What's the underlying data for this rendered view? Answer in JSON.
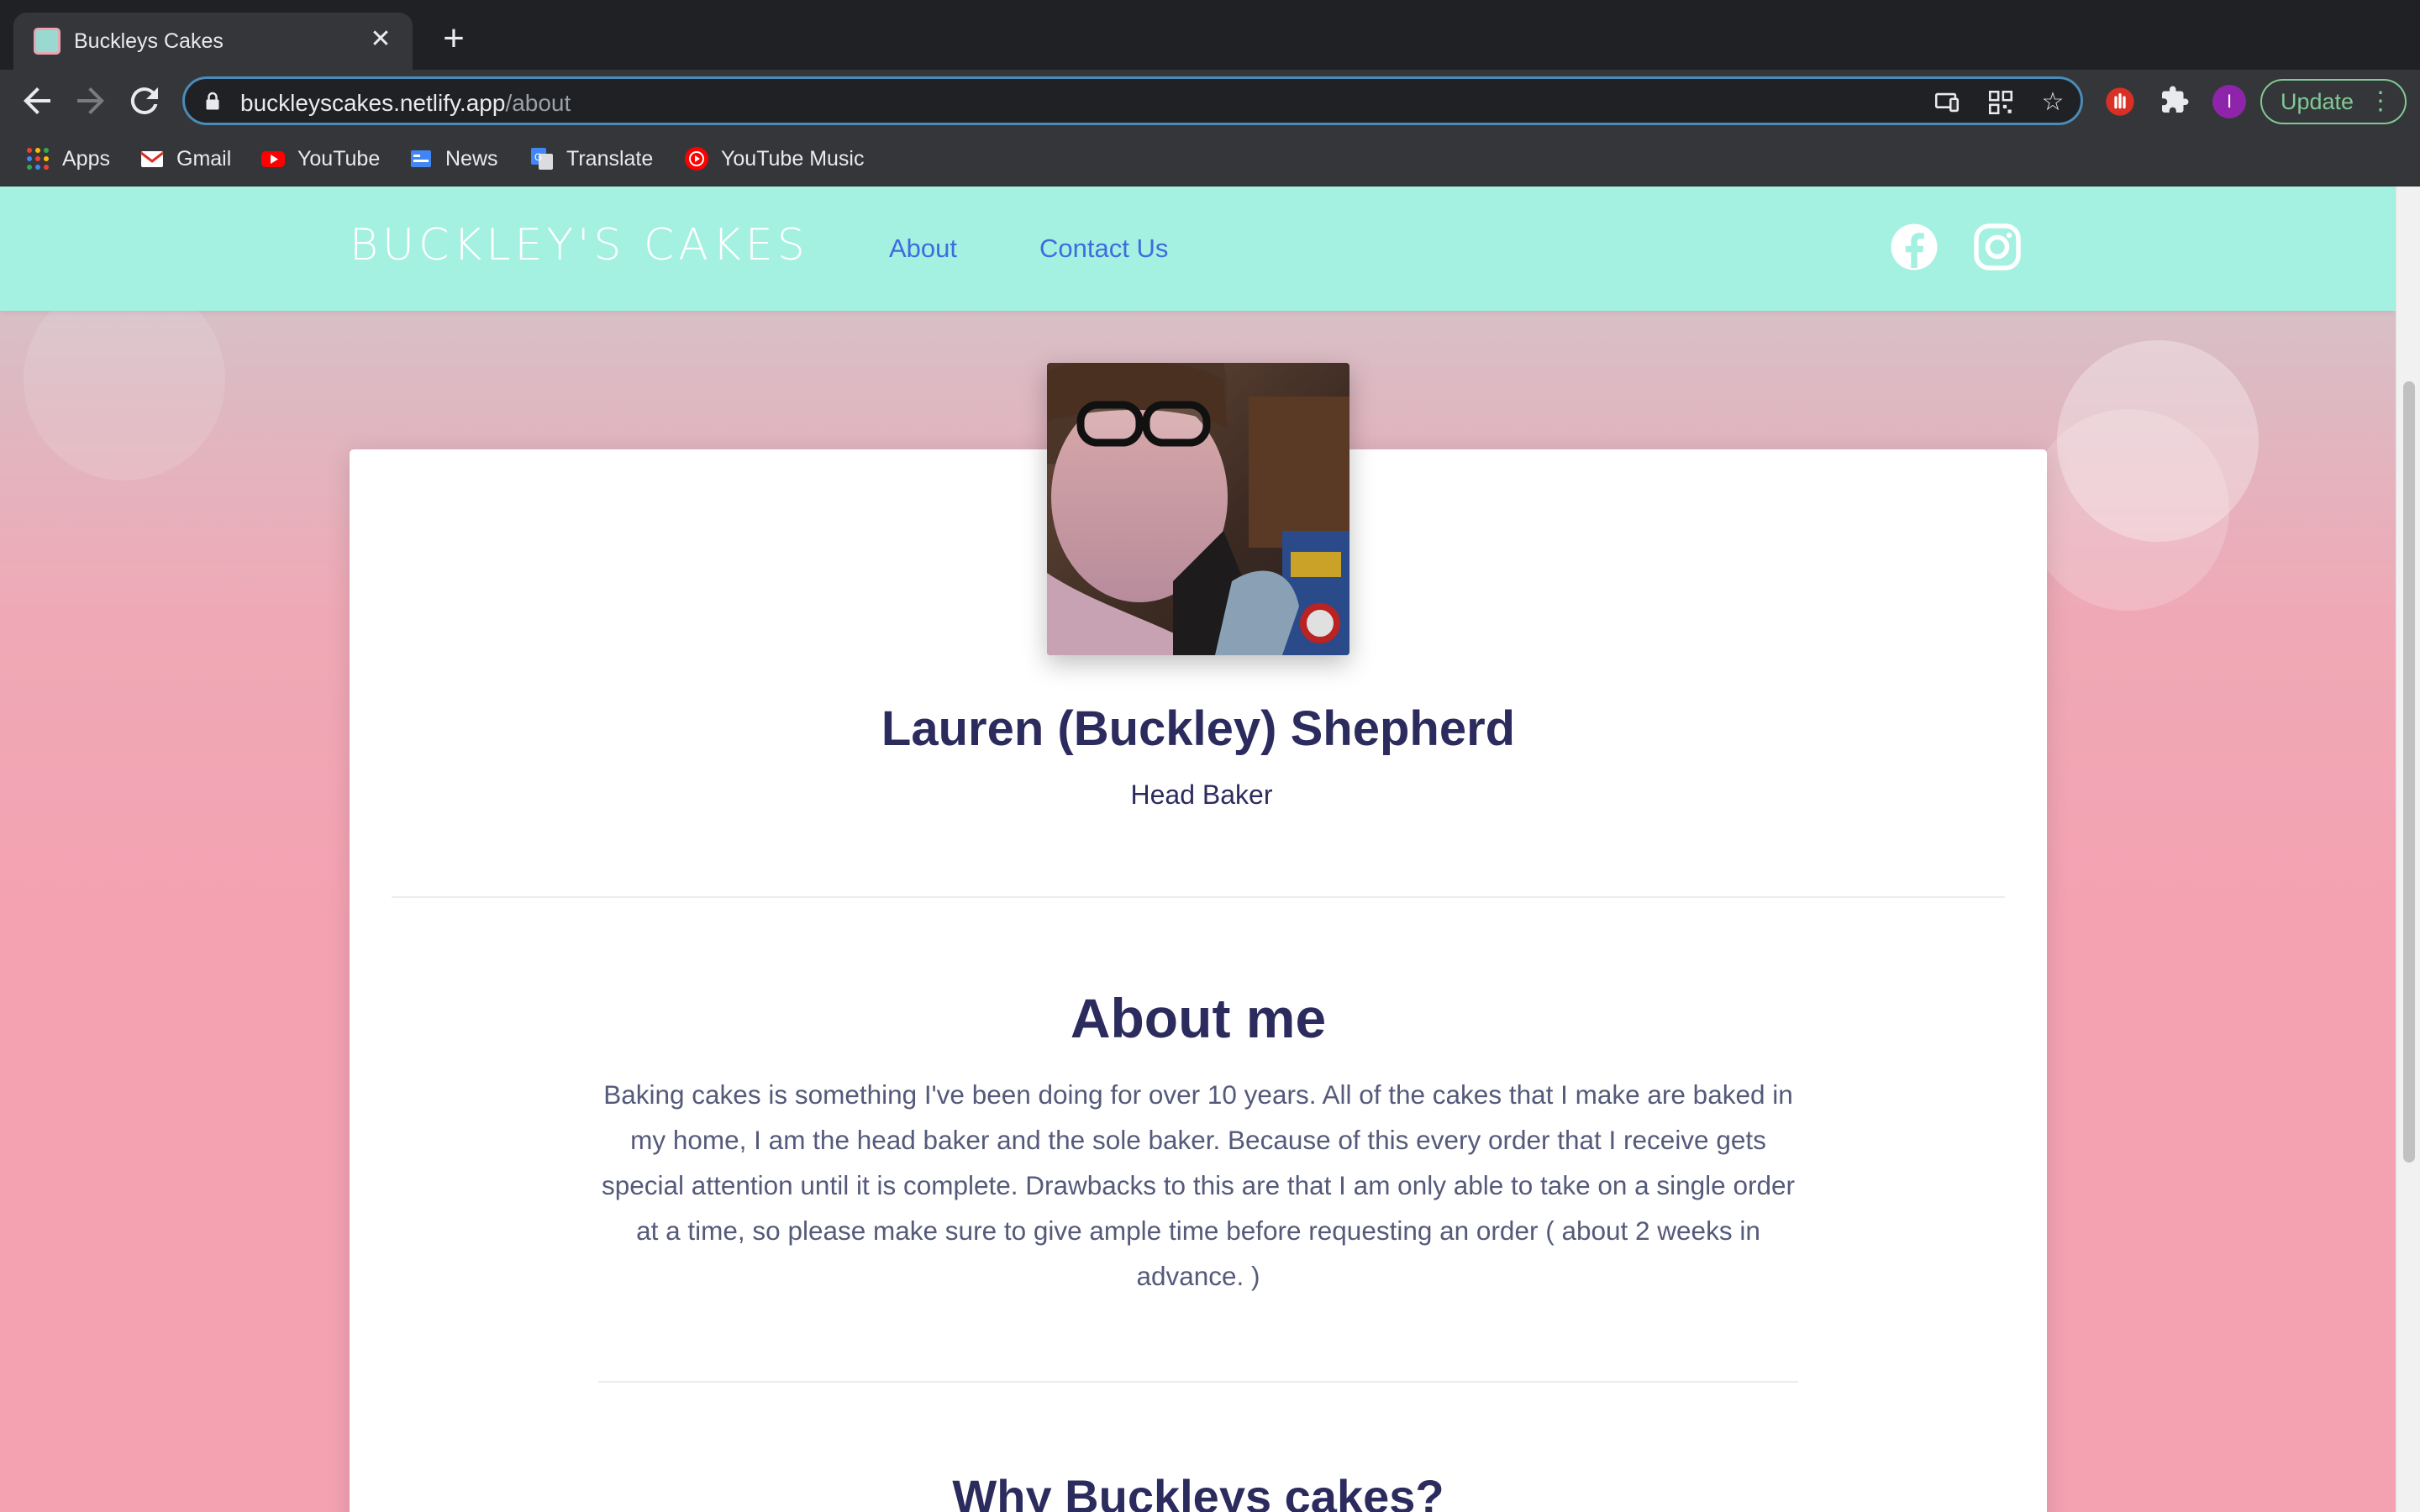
{
  "browser": {
    "tab_title": "Buckleys Cakes",
    "url_domain": "buckleyscakes.netlify.app",
    "url_path": "/about",
    "update_label": "Update",
    "profile_initial": "I",
    "bookmarks": [
      "Apps",
      "Gmail",
      "YouTube",
      "News",
      "Translate",
      "YouTube Music"
    ]
  },
  "site": {
    "logo": "BUCKLEY'S CAKES",
    "nav": {
      "about": "About",
      "contact": "Contact Us"
    }
  },
  "profile": {
    "name": "Lauren (Buckley) Shepherd",
    "role": "Head Baker"
  },
  "about": {
    "title": "About me",
    "text": "Baking cakes is something I've been doing for over 10 years. All of the cakes that I make are baked in my home, I am the head baker and the sole baker. Because of this every order that I receive gets special attention until it is complete. Drawbacks to this are that I am only able to take on a single order at a time, so please make sure to give ample time before requesting an order ( about 2 weeks in advance. )"
  },
  "why": {
    "title": "Why Buckleys cakes?"
  },
  "colors": {
    "header_bg": "#a4f1e1",
    "nav_link": "#3f6be0",
    "heading": "#2c2b5e",
    "page_pink": "#f4a2b2"
  }
}
